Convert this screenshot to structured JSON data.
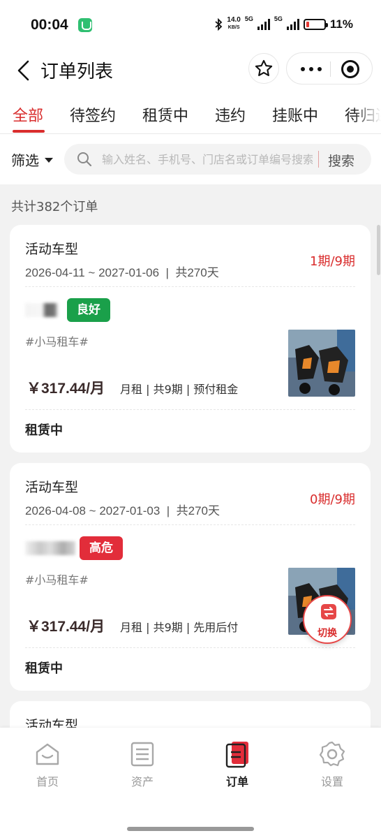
{
  "status_bar": {
    "time": "00:04",
    "net_speed_top": "14.0",
    "net_speed_unit": "KB/S",
    "sim1": "5G",
    "sim2": "5G",
    "battery": "11%"
  },
  "header": {
    "title": "订单列表",
    "icons": [
      "back-icon",
      "star-icon",
      "more-icon",
      "target-icon"
    ]
  },
  "tabs": [
    {
      "label": "全部",
      "active": true
    },
    {
      "label": "待签约"
    },
    {
      "label": "租赁中"
    },
    {
      "label": "违约"
    },
    {
      "label": "挂账中"
    },
    {
      "label": "待归还"
    }
  ],
  "filter": {
    "label": "筛选",
    "search_placeholder": "输入姓名、手机号、门店名或订单编号搜索",
    "search_button": "搜索"
  },
  "total_count": "共计382个订单",
  "orders": [
    {
      "model": "活动车型",
      "date_range": "2026-04-11 ~ 2027-01-06",
      "duration": "共270天",
      "period": "1期/9期",
      "credit_badge": "良好",
      "tag": "#小马租车#",
      "price": "￥317.44/月",
      "terms": "月租 | 共9期 | 预付租金",
      "status": "租赁中"
    },
    {
      "model": "活动车型",
      "date_range": "2026-04-08 ~ 2027-01-03",
      "duration": "共270天",
      "period": "0期/9期",
      "credit_badge": "高危",
      "tag": "#小马租车#",
      "price": "￥317.44/月",
      "terms": "月租 | 共9期 | 先用后付",
      "status": "租赁中"
    }
  ],
  "partial_card_model": "活动车型",
  "switch_fab": "切换",
  "bottom_nav": [
    {
      "label": "首页",
      "icon": "home-icon"
    },
    {
      "label": "资产",
      "icon": "assets-icon"
    },
    {
      "label": "订单",
      "icon": "orders-icon",
      "active": true
    },
    {
      "label": "设置",
      "icon": "settings-icon"
    }
  ],
  "colors": {
    "accent": "#d92d2d",
    "good": "#1aa04a",
    "danger": "#e22d3a"
  }
}
